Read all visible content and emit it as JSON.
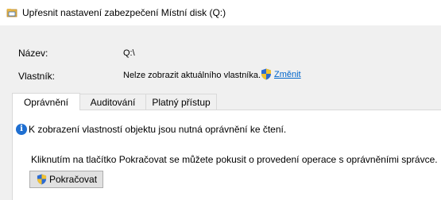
{
  "window": {
    "title": "Upřesnit nastavení zabezpečení Místní disk (Q:)",
    "icon": "folder-security-icon"
  },
  "properties": {
    "name_label": "Název:",
    "name_value": "Q:\\",
    "owner_label": "Vlastník:",
    "owner_value": "Nelze zobrazit aktuálního vlastníka.",
    "change_link": "Změnit",
    "change_link_icon": "uac-shield-icon"
  },
  "tabs": [
    {
      "label": "Oprávnění",
      "active": true
    },
    {
      "label": "Auditování",
      "active": false
    },
    {
      "label": "Platný přístup",
      "active": false
    }
  ],
  "panel": {
    "info_text": "K zobrazení vlastností objektu jsou nutná oprávnění ke čtení.",
    "help_text": "Kliknutím na tlačítko Pokračovat se můžete pokusit o provedení operace s oprávněními správce.",
    "continue_button": "Pokračovat"
  },
  "colors": {
    "link": "#0066cc",
    "info_icon": "#1f6fd1",
    "window_bg": "#f0f0f0",
    "panel_bg": "#ffffff"
  }
}
